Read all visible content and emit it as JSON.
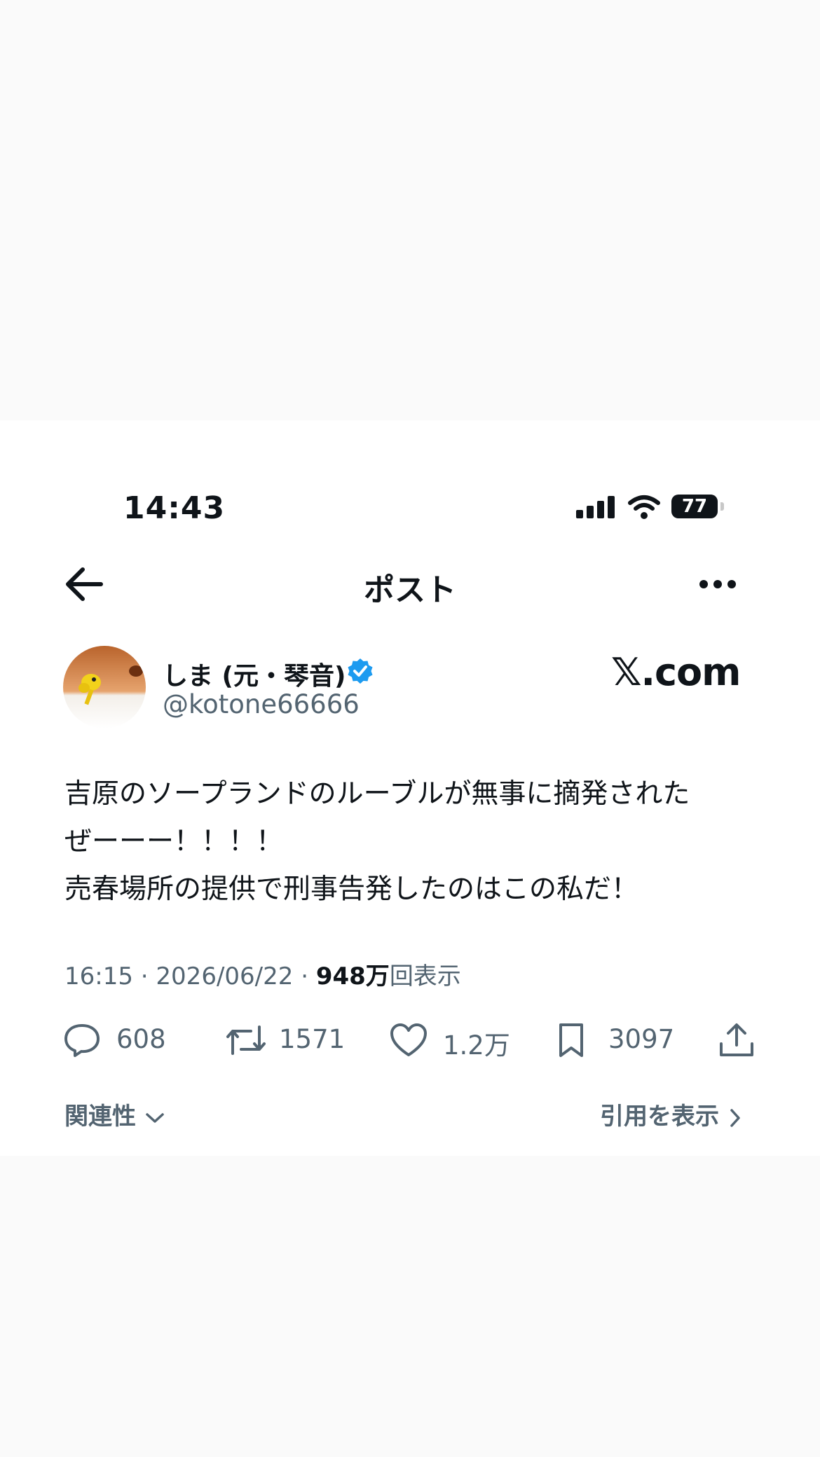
{
  "status_bar": {
    "time": "14:43",
    "battery": "77"
  },
  "nav": {
    "title": "ポスト",
    "back_icon": "arrow-left-icon",
    "more_icon": "more-horizontal-icon"
  },
  "author": {
    "name": "しま (元・琴音)",
    "handle": "@kotone66666",
    "verified": true
  },
  "watermark": "𝕏.com",
  "tweet": {
    "lines": [
      "吉原のソープランドのルーブルが無事に摘発された",
      "ぜーーー！！！！",
      "売春場所の提供で刑事告発したのはこの私だ！"
    ],
    "time": "16:15",
    "date": "2026/06/22",
    "views": "948万",
    "views_suffix": "回表示"
  },
  "actions": {
    "replies": "608",
    "reposts": "1571",
    "likes": "1.2万",
    "bookmarks": "3097"
  },
  "footer": {
    "sort_label": "関連性",
    "quotes_label": "引用を表示"
  },
  "colors": {
    "text": "#0f1419",
    "secondary": "#536471",
    "verified": "#1d9bf0"
  }
}
